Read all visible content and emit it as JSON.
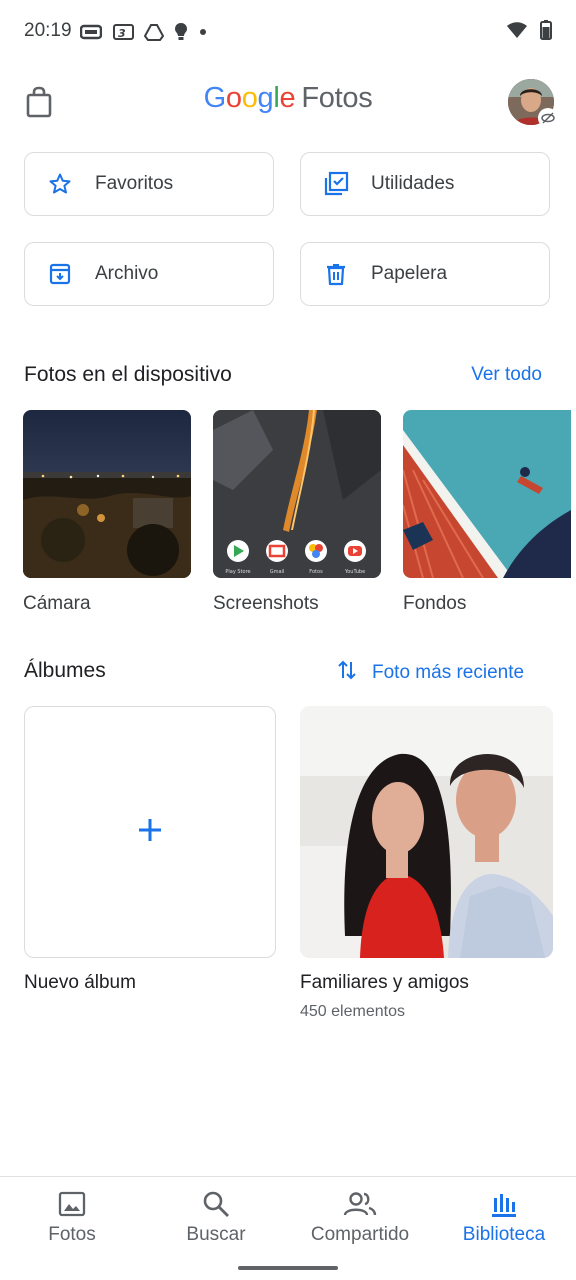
{
  "status_bar": {
    "time": "20:19"
  },
  "header": {
    "brand_google": [
      "G",
      "o",
      "o",
      "g",
      "l",
      "e"
    ],
    "brand_colors": [
      "#4285F4",
      "#EA4335",
      "#FBBC05",
      "#4285F4",
      "#34A853",
      "#EA4335"
    ],
    "brand_product": "Fotos"
  },
  "quick_actions": [
    {
      "label": "Favoritos",
      "icon": "star-icon"
    },
    {
      "label": "Utilidades",
      "icon": "checklist-icon"
    },
    {
      "label": "Archivo",
      "icon": "archive-icon"
    },
    {
      "label": "Papelera",
      "icon": "trash-icon"
    }
  ],
  "device_section": {
    "title": "Fotos en el dispositivo",
    "link": "Ver todo",
    "folders": [
      {
        "label": "Cámara"
      },
      {
        "label": "Screenshots",
        "dock_labels": [
          "Play Store",
          "Gmail",
          "Fotos",
          "YouTube"
        ]
      },
      {
        "label": "Fondos"
      }
    ]
  },
  "albums_section": {
    "title": "Álbumes",
    "sort_label": "Foto más reciente",
    "new_album_label": "Nuevo álbum",
    "album": {
      "name": "Familiares y amigos",
      "count": "450 elementos"
    }
  },
  "bottom_nav": [
    {
      "label": "Fotos",
      "icon": "photo-icon",
      "active": false
    },
    {
      "label": "Buscar",
      "icon": "search-icon",
      "active": false
    },
    {
      "label": "Compartido",
      "icon": "people-icon",
      "active": false
    },
    {
      "label": "Biblioteca",
      "icon": "library-icon",
      "active": true
    }
  ],
  "colors": {
    "accent": "#1a73e8",
    "border": "#dadce0",
    "text": "#202124"
  }
}
